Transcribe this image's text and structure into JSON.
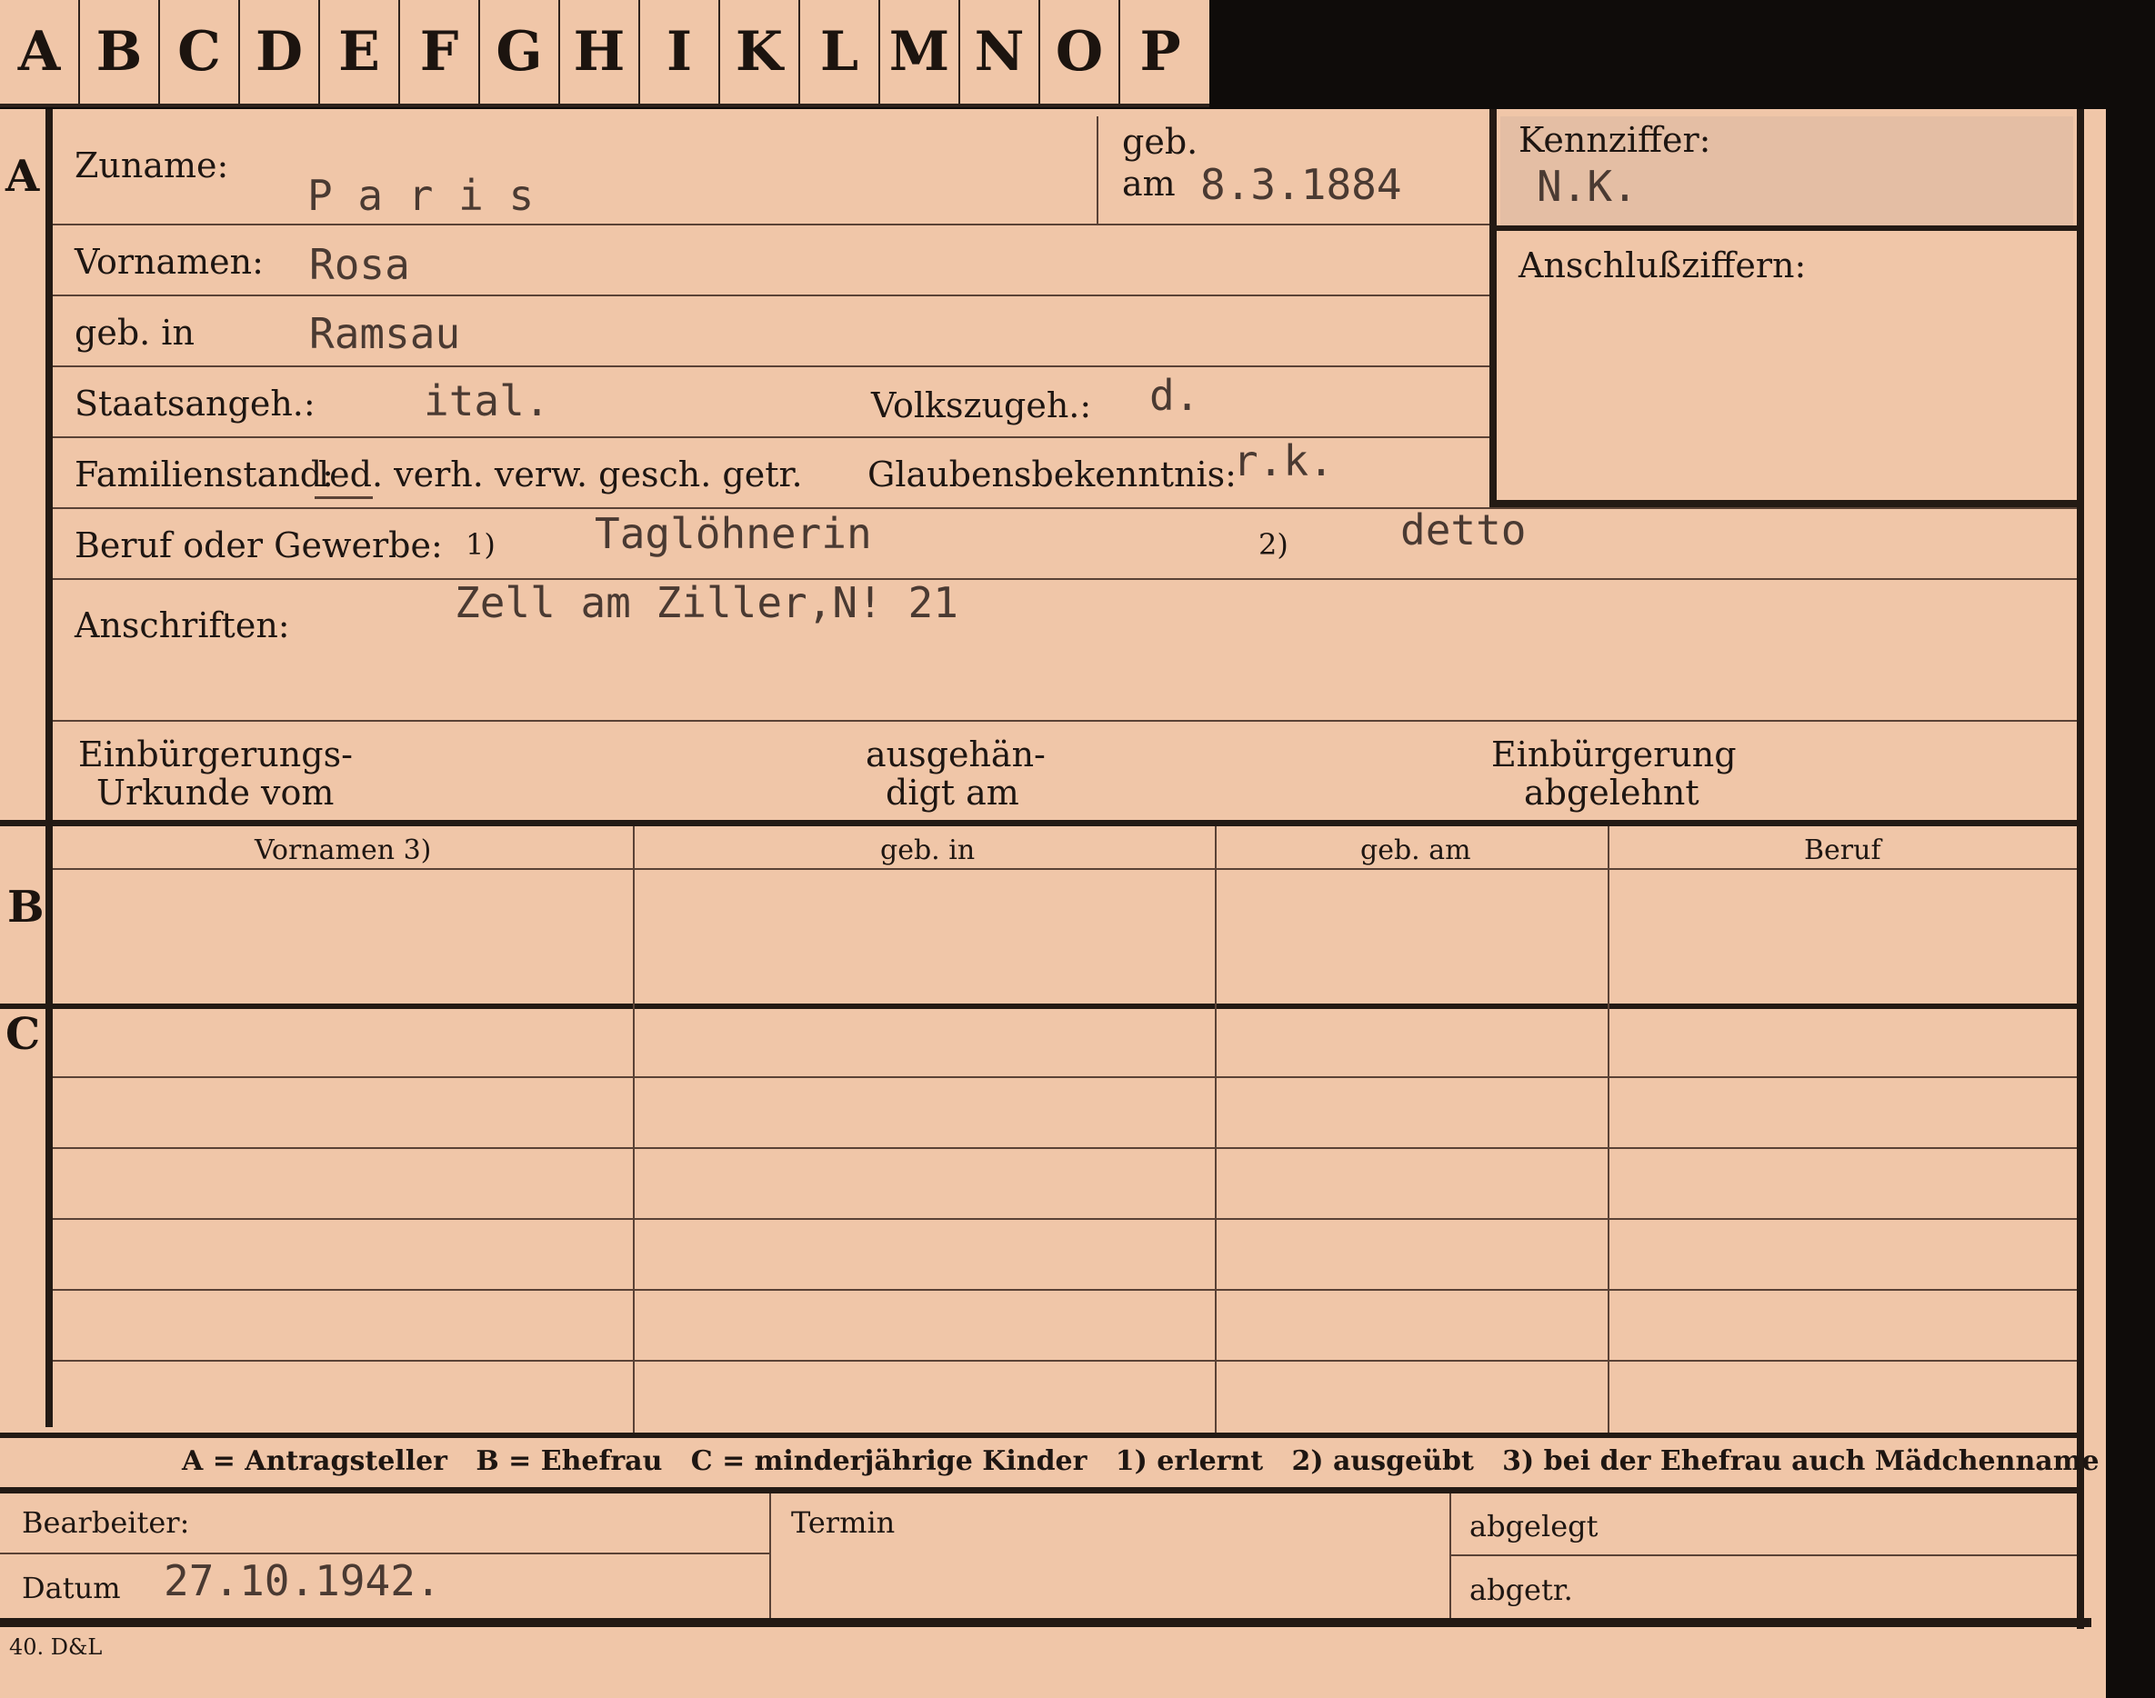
{
  "tabs": [
    "A",
    "B",
    "C",
    "D",
    "E",
    "F",
    "G",
    "H",
    "I",
    "K",
    "L",
    "M",
    "N",
    "O",
    "P"
  ],
  "sections": {
    "a": "A",
    "b": "B",
    "c": "C"
  },
  "fields": {
    "zuname_label": "Zuname:",
    "zuname": "P a r i s",
    "geb_label": "geb.",
    "am_label": "am",
    "geb_am": "8.3.1884",
    "kennziffer_label": "Kennziffer:",
    "kennziffer": "N.K.",
    "anschluss_label": "Anschlußziffern:",
    "vornamen_label": "Vornamen:",
    "vornamen": "Rosa",
    "geb_in_label": "geb. in",
    "geb_in": "Ramsau",
    "staats_label": "Staatsangeh.:",
    "staats": "ital.",
    "volks_label": "Volkszugeh.:",
    "volks": "d.",
    "familienstand_label": "Familienstand:",
    "familienstand_options": "led. verh. verw. gesch. getr.",
    "glauben_label": "Glaubensbekenntnis:",
    "glauben": "r.k.",
    "beruf_label": "Beruf oder Gewerbe:",
    "beruf_note1": "1)",
    "beruf1": "Taglöhnerin",
    "beruf_note2": "2)",
    "beruf2": "detto",
    "anschriften_label": "Anschriften:",
    "anschriften": "Zell am Ziller,N! 21",
    "einb_urkunde_1": "Einbürgerungs-",
    "einb_urkunde_2": "Urkunde vom",
    "ausgeh_1": "ausgehän-",
    "ausgeh_2": "digt am",
    "einb_abg_1": "Einbürgerung",
    "einb_abg_2": "abgelehnt"
  },
  "table_headers": [
    "Vornamen 3)",
    "geb. in",
    "geb. am",
    "Beruf"
  ],
  "legend": "A = Antragsteller   B = Ehefrau   C = minderjährige Kinder   1) erlernt   2) ausgeübt   3) bei der Ehefrau auch Mädchenname",
  "footer": {
    "bearbeiter_label": "Bearbeiter:",
    "datum_label": "Datum",
    "datum": "27.10.1942.",
    "termin_label": "Termin",
    "abgelegt_label": "abgelegt",
    "abgetr_label": "abgetr.",
    "print_code": "40. D&L"
  }
}
